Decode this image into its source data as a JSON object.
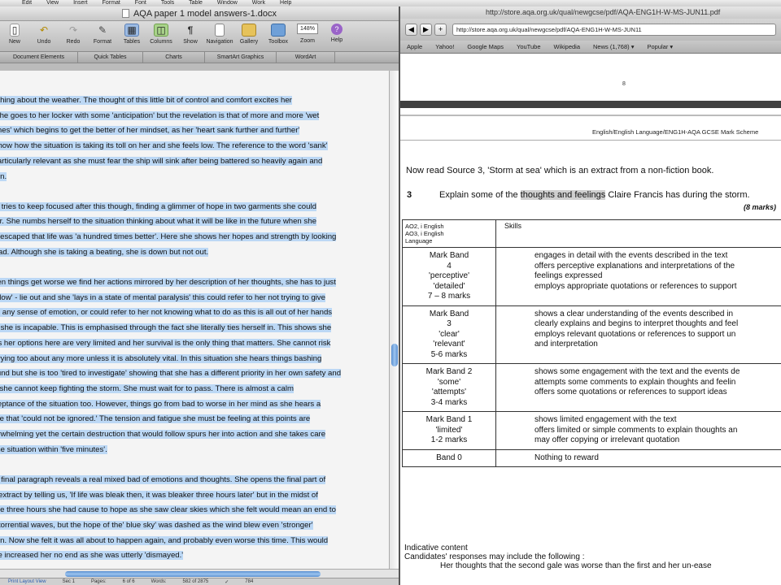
{
  "menubar": {
    "items": [
      "",
      "Edit",
      "View",
      "Insert",
      "Format",
      "Font",
      "Tools",
      "Table",
      "Window",
      "Work",
      "Help"
    ]
  },
  "word": {
    "title": "AQA paper 1 model answers-1.docx",
    "toolbar": {
      "buttons": [
        {
          "label": "New",
          "icon": "new-doc-icon"
        },
        {
          "label": "Undo",
          "icon": "undo-icon"
        },
        {
          "label": "Redo",
          "icon": "redo-icon"
        },
        {
          "label": "Format",
          "icon": "format-brush-icon"
        },
        {
          "label": "Tables",
          "icon": "table-icon"
        },
        {
          "label": "Columns",
          "icon": "columns-icon"
        },
        {
          "label": "Show",
          "icon": "pilcrow-icon"
        },
        {
          "label": "Navigation",
          "icon": "navigation-icon"
        },
        {
          "label": "Gallery",
          "icon": "gallery-icon"
        },
        {
          "label": "Toolbox",
          "icon": "toolbox-icon"
        },
        {
          "label": "Zoom",
          "icon": "zoom-icon"
        },
        {
          "label": "Help",
          "icon": "help-icon"
        }
      ],
      "zoom_value": "148%"
    },
    "ribbon_tabs": [
      "Document Elements",
      "Quick Tables",
      "Charts",
      "SmartArt Graphics",
      "WordArt"
    ],
    "paragraphs": [
      [
        {
          "text": "anything about the weather. The thought of this little bit of control and comfort excites her",
          "hl": true
        },
        {
          "text": "so she goes to her locker with some 'anticipation' but the revelation is that of more and more 'wet",
          "hl": true
        },
        {
          "text": "clothes' which begins to get the better of her mindset, as her 'heart sank further and further'",
          "hl": true
        },
        {
          "text": "to show how the situation is taking its toll on her and she feels low. The reference to the word 'sank'",
          "hl": true
        },
        {
          "text": "is particularly relevant as she must fear the ship will sink after being battered so heavily again and",
          "hl": true
        },
        {
          "text": "again.",
          "hl": true
        }
      ],
      [
        {
          "text": "She tries to keep focused after this though, finding a glimmer of hope in two garments she could",
          "hl": true
        },
        {
          "text": "wear. She numbs herself to the situation thinking about what it will be like in the future when she",
          "hl": true
        },
        {
          "text": "has escaped that life was 'a hundred times better'. Here she shows her hopes and strength by looking",
          "hl": true
        },
        {
          "text": "ahead. Although she is taking a beating, she is down but not out.",
          "hl": true
        }
      ],
      [
        {
          "text": "When things get worse we find her actions mirrored by her description of her thoughts, she has to just",
          "hl": true
        },
        {
          "text": "'Lie low' - lie out and she 'lays in a state of mental paralysis' this could refer to her not trying to give",
          "hl": true
        },
        {
          "text": "in to any sense of emotion, or could refer to her not knowing what to do as this is all out of her hands",
          "hl": true
        },
        {
          "text": "and she is incapable. This is emphasised through the fact she literally ties herself in. This shows she",
          "hl": true
        },
        {
          "text": "feels her options here are very limited and her survival is the only thing that matters. She cannot risk",
          "hl": true
        },
        {
          "text": "worrying too about any more unless it is absolutely vital. In this situation she hears things bashing",
          "hl": true
        },
        {
          "text": "around but she is too 'tired to investigate' showing that she has a different priority in her own safety and",
          "hl": true
        },
        {
          "text": "life, she cannot keep fighting the storm. She must wait for to pass. There is almost a calm",
          "hl": true
        },
        {
          "text": "acceptance of the situation too. However, things go from bad to worse in her mind as she hears a",
          "hl": true
        },
        {
          "text": "noise that 'could not be ignored.' The tension and fatigue she must be feeling at this points are",
          "hl": true
        },
        {
          "text": "overwhelming yet the certain destruction that would follow spurs her into action and she takes care",
          "hl": true
        },
        {
          "text": "of the situation within 'five minutes'.",
          "hl": true
        }
      ],
      [
        {
          "text": "The final paragraph reveals a real mixed bad of emotions and thoughts. She opens the final part of",
          "hl": true
        },
        {
          "text": "the extract by telling us, 'If life was bleak then, it was bleaker three hours later' but in the midst of",
          "hl": true
        },
        {
          "text": "those three hours she had cause to hope as she saw clear skies which she felt would mean an end to",
          "hl": true
        },
        {
          "text": "the torrential waves, but the hope of the' blue sky' was dashed as the wind blew even 'stronger'",
          "hl": true
        },
        {
          "text": "again. Now she felt it was all about to happen again, and probably even worse this time. This would",
          "hl": true
        },
        {
          "text": "have increased her no end as she was utterly 'dismayed.'",
          "hl": true
        }
      ]
    ],
    "status": [
      "Print Layout View",
      "Sec 1",
      "Pages:",
      "6 of 6",
      "Words:",
      "582 of 2875",
      "✓",
      "784"
    ]
  },
  "browser": {
    "title": "http://store.aqa.org.uk/qual/newgcse/pdf/AQA-ENG1H-W-MS-JUN11.pdf",
    "url": "http://store.aqa.org.uk/qual/newgcse/pdf/AQA-ENG1H-W-MS-JUN11",
    "nav_buttons": [
      "◀",
      "▶",
      "+"
    ],
    "bookmarks": [
      "Apple",
      "Yahoo!",
      "Google Maps",
      "YouTube",
      "Wikipedia",
      "News (1,768) ▾",
      "Popular ▾"
    ],
    "pdf": {
      "page_num": "8",
      "running_head": "English/English Language/ENG1H-AQA GCSE Mark Scheme",
      "intro": "Now read Source 3, 'Storm at sea' which is an extract from a non-fiction book.",
      "question_number": "3",
      "question_before": "Explain some of the ",
      "question_highlight": "thoughts and feelings",
      "question_after": " Claire Francis has during the storm.",
      "question_marks": "(8 marks)",
      "table_header": {
        "ao_lines": [
          "AO2, i English",
          "AO3, i English",
          "Language"
        ],
        "skills": "Skills"
      },
      "bands": [
        {
          "label_lines": [
            "Mark Band",
            "4",
            "'perceptive'",
            "'detailed'",
            "7 – 8 marks"
          ],
          "desc_lines": [
            "engages in detail  with the events described in the text",
            "offers  perceptive explanations and interpretations of the",
            "feelings expressed",
            "employs appropriate quotations  or references to support"
          ]
        },
        {
          "label_lines": [
            "Mark Band",
            "3",
            "'clear'",
            "'relevant'",
            "5-6 marks"
          ],
          "desc_lines": [
            "shows a clear understanding of the events described in",
            "clearly explains and begins to interpret thoughts and feel",
            "employs relevant quotations or references to support un",
            "and interpretation"
          ]
        },
        {
          "label_lines": [
            "Mark Band 2",
            "'some'",
            "'attempts'",
            "3-4 marks"
          ],
          "desc_lines": [
            "shows some engagement with the text and the events de",
            "attempts some comments to explain thoughts and feelin",
            "offers some quotations or references to support  ideas"
          ]
        },
        {
          "label_lines": [
            "Mark Band 1",
            "'limited'",
            "1-2 marks"
          ],
          "desc_lines": [
            "shows limited engagement with the text",
            "offers limited or simple comments to explain thoughts an",
            "may offer copying or irrelevant quotation"
          ]
        },
        {
          "label_lines": [
            "Band 0"
          ],
          "desc_lines": [
            "Nothing to reward"
          ]
        }
      ],
      "indicative": [
        "Indicative content",
        "Candidates' responses may include the following :",
        "Her thoughts that the second gale was worse than the first and her un-ease"
      ]
    }
  }
}
